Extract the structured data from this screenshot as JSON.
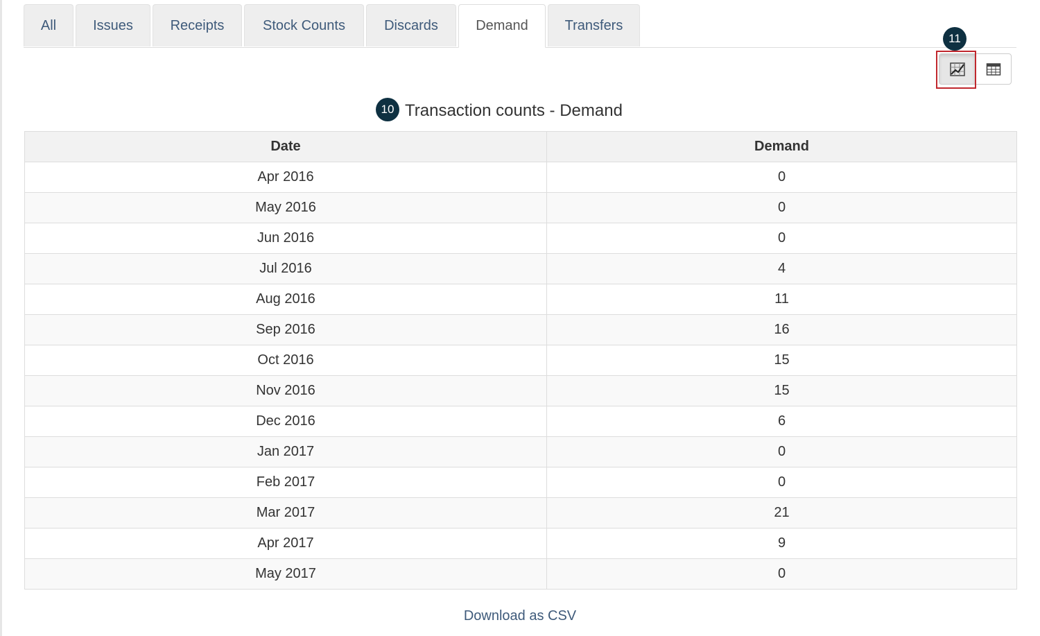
{
  "tabs": [
    {
      "label": "All"
    },
    {
      "label": "Issues"
    },
    {
      "label": "Receipts"
    },
    {
      "label": "Stock Counts"
    },
    {
      "label": "Discards"
    },
    {
      "label": "Demand",
      "active": true
    },
    {
      "label": "Transfers"
    }
  ],
  "view_toggle": {
    "chart_icon": "chart-icon",
    "table_icon": "table-icon",
    "active": "chart"
  },
  "markers": {
    "toggle": "11",
    "title": "10"
  },
  "title": "Transaction counts - Demand",
  "table": {
    "headers": [
      "Date",
      "Demand"
    ],
    "rows": [
      [
        "Apr 2016",
        "0"
      ],
      [
        "May 2016",
        "0"
      ],
      [
        "Jun 2016",
        "0"
      ],
      [
        "Jul 2016",
        "4"
      ],
      [
        "Aug 2016",
        "11"
      ],
      [
        "Sep 2016",
        "16"
      ],
      [
        "Oct 2016",
        "15"
      ],
      [
        "Nov 2016",
        "15"
      ],
      [
        "Dec 2016",
        "6"
      ],
      [
        "Jan 2017",
        "0"
      ],
      [
        "Feb 2017",
        "0"
      ],
      [
        "Mar 2017",
        "21"
      ],
      [
        "Apr 2017",
        "9"
      ],
      [
        "May 2017",
        "0"
      ]
    ]
  },
  "download_link": "Download as CSV",
  "colors": {
    "highlight": "#c0272d",
    "marker": "#0e3041",
    "link": "#3e5a7a"
  }
}
